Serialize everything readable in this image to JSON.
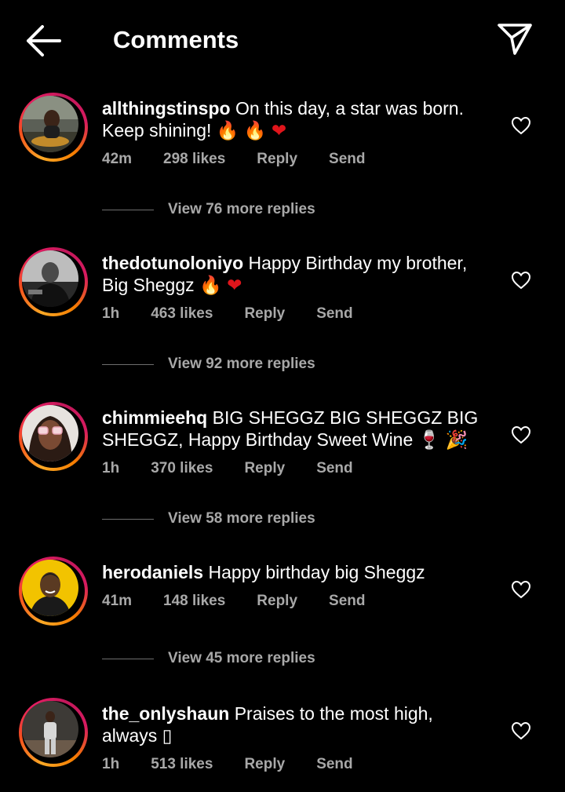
{
  "header": {
    "title": "Comments",
    "back_icon": "arrow-left-icon",
    "send_icon": "paper-plane-icon"
  },
  "comments": [
    {
      "username": "allthingstinspo",
      "text": "On this day, a star was born. Keep shining!",
      "emojis": [
        "🔥",
        "🔥",
        "❤"
      ],
      "time": "42m",
      "likes": "298 likes",
      "reply": "Reply",
      "send": "Send",
      "view_replies": "View 76 more replies"
    },
    {
      "username": "thedotunoloniyo",
      "text": "Happy Birthday my brother, Big Sheggz",
      "emojis": [
        "🔥",
        "❤"
      ],
      "time": "1h",
      "likes": "463 likes",
      "reply": "Reply",
      "send": "Send",
      "view_replies": "View 92 more replies"
    },
    {
      "username": "chimmieehq",
      "text": "BIG SHEGGZ BIG SHEGGZ BIG SHEGGZ, Happy Birthday Sweet Wine",
      "emojis": [
        "🍷",
        "🎉"
      ],
      "time": "1h",
      "likes": "370 likes",
      "reply": "Reply",
      "send": "Send",
      "view_replies": "View 58 more replies"
    },
    {
      "username": "herodaniels",
      "text": "Happy birthday big Sheggz",
      "emojis": [],
      "time": "41m",
      "likes": "148 likes",
      "reply": "Reply",
      "send": "Send",
      "view_replies": "View 45 more replies"
    },
    {
      "username": "the_onlyshaun",
      "text": "Praises to the most high, always",
      "emojis": [
        "▯"
      ],
      "time": "1h",
      "likes": "513 likes",
      "reply": "Reply",
      "send": "Send"
    }
  ],
  "colors": {
    "background": "#000000",
    "text": "#ffffff",
    "meta": "#a8a8a8"
  }
}
